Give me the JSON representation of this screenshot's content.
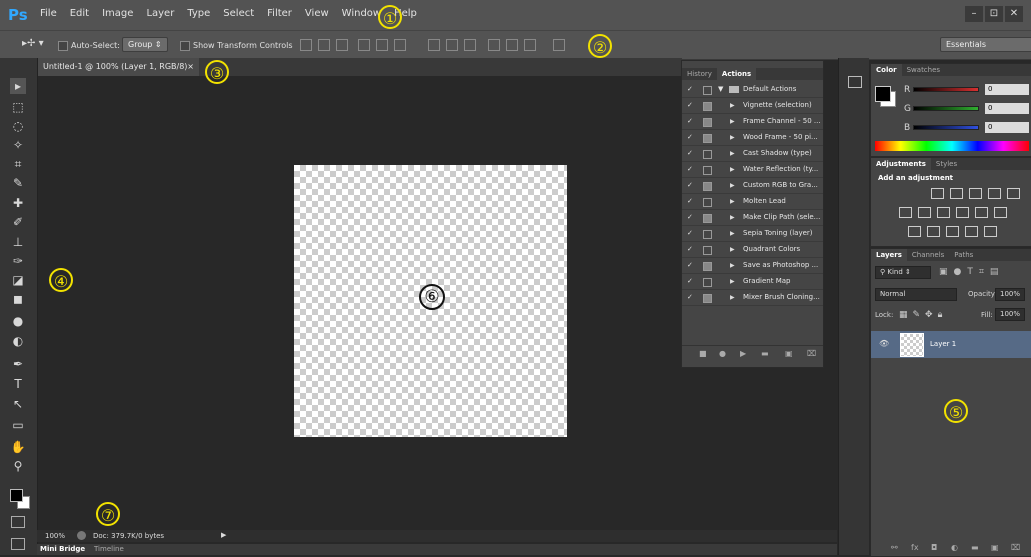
{
  "app": {
    "logo": "Ps"
  },
  "menu": [
    "File",
    "Edit",
    "Image",
    "Layer",
    "Type",
    "Select",
    "Filter",
    "View",
    "Window",
    "Help"
  ],
  "window_controls": [
    "–",
    "⊡",
    "✕"
  ],
  "options": {
    "auto_select_label": "Auto-Select:",
    "auto_select_value": "Group",
    "transform_label": "Show Transform Controls",
    "workspace": "Essentials"
  },
  "document_tab": {
    "title": "Untitled-1 @ 100% (Layer 1, RGB/8)",
    "close": "×"
  },
  "tools": [
    "▸",
    "⬚",
    "◌",
    "✧",
    "⌗",
    "✎",
    "✚",
    "✐",
    "⊥",
    "✑",
    "◪",
    "◼",
    "●",
    "◐",
    "✒",
    "T",
    "↖",
    "▭",
    "✋",
    "⚲"
  ],
  "status": {
    "zoom": "100%",
    "doc": "Doc: 379.7K/0 bytes"
  },
  "bottom_tabs": [
    "Mini Bridge",
    "Timeline"
  ],
  "actions_panel": {
    "tabs": [
      "History",
      "Actions"
    ],
    "set_name": "Default Actions",
    "items": [
      {
        "label": "Vignette (selection)",
        "dialog": true
      },
      {
        "label": "Frame Channel - 50 ...",
        "dialog": true
      },
      {
        "label": "Wood Frame - 50 pi...",
        "dialog": true
      },
      {
        "label": "Cast Shadow (type)",
        "dialog": false
      },
      {
        "label": "Water Reflection (ty...",
        "dialog": false
      },
      {
        "label": "Custom RGB to Gra...",
        "dialog": true
      },
      {
        "label": "Molten Lead",
        "dialog": false
      },
      {
        "label": "Make Clip Path (sele...",
        "dialog": true
      },
      {
        "label": "Sepia Toning (layer)",
        "dialog": false
      },
      {
        "label": "Quadrant Colors",
        "dialog": false
      },
      {
        "label": "Save as Photoshop ...",
        "dialog": true
      },
      {
        "label": "Gradient Map",
        "dialog": false
      },
      {
        "label": "Mixer Brush Cloning...",
        "dialog": true
      }
    ]
  },
  "color_panel": {
    "tabs": [
      "Color",
      "Swatches"
    ],
    "channels": [
      {
        "name": "R",
        "value": "0",
        "color": "#d83030"
      },
      {
        "name": "G",
        "value": "0",
        "color": "#30b030"
      },
      {
        "name": "B",
        "value": "0",
        "color": "#3050e0"
      }
    ]
  },
  "adjustments_panel": {
    "tabs": [
      "Adjustments",
      "Styles"
    ],
    "heading": "Add an adjustment"
  },
  "layers_panel": {
    "tabs": [
      "Layers",
      "Channels",
      "Paths"
    ],
    "kind": "Kind",
    "blend_mode": "Normal",
    "opacity_label": "Opacity:",
    "opacity": "100%",
    "lock_label": "Lock:",
    "fill_label": "Fill:",
    "fill": "100%",
    "layer_name": "Layer 1"
  },
  "callouts": [
    "①",
    "②",
    "③",
    "④",
    "⑤",
    "⑥",
    "⑦"
  ],
  "colors": {
    "accent_callout": "#f2e200",
    "selected_layer": "#566a86"
  }
}
